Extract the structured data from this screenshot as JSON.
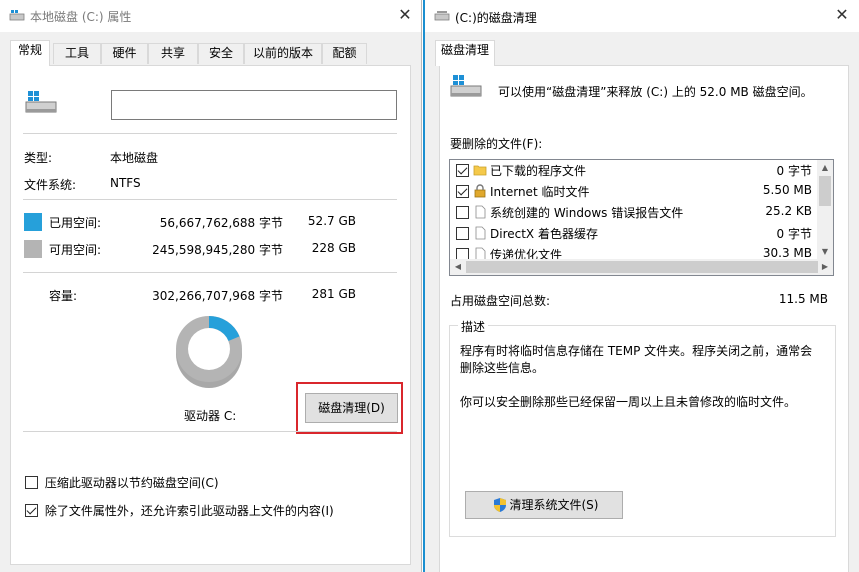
{
  "left_window": {
    "title": "本地磁盘 (C:) 属性",
    "tabs": [
      "常规",
      "工具",
      "硬件",
      "共享",
      "安全",
      "以前的版本",
      "配额"
    ],
    "active_tab": "常规",
    "drive_name_value": "",
    "type_label": "类型:",
    "type_value": "本地磁盘",
    "fs_label": "文件系统:",
    "fs_value": "NTFS",
    "used": {
      "label": "已用空间:",
      "bytes": "56,667,762,688 字节",
      "size": "52.7 GB",
      "color": "#26a0da"
    },
    "free": {
      "label": "可用空间:",
      "bytes": "245,598,945,280 字节",
      "size": "228 GB",
      "color": "#b4b4b4"
    },
    "capacity": {
      "label": "容量:",
      "bytes": "302,266,707,968 字节",
      "size": "281 GB"
    },
    "used_fraction": 0.187,
    "drive_label": "驱动器 C:",
    "cleanup_button": "磁盘清理(D)",
    "compress_label": "压缩此驱动器以节约磁盘空间(C)",
    "compress_checked": false,
    "index_label": "除了文件属性外，还允许索引此驱动器上文件的内容(I)",
    "index_checked": true
  },
  "right_window": {
    "title": "(C:)的磁盘清理",
    "tab": "磁盘清理",
    "intro": "可以使用“磁盘清理”来释放  (C:) 上的 52.0 MB 磁盘空间。",
    "files_label": "要删除的文件(F):",
    "files": [
      {
        "name": "已下载的程序文件",
        "size": "0 字节",
        "checked": true,
        "icon": "folder-icon"
      },
      {
        "name": "Internet 临时文件",
        "size": "5.50 MB",
        "checked": true,
        "icon": "lock-icon"
      },
      {
        "name": "系统创建的 Windows 错误报告文件",
        "size": "25.2 KB",
        "checked": false,
        "icon": "file-icon"
      },
      {
        "name": "DirectX 着色器缓存",
        "size": "0 字节",
        "checked": false,
        "icon": "file-icon"
      },
      {
        "name": "传递优化文件",
        "size": "30.3 MB",
        "checked": false,
        "icon": "file-icon"
      }
    ],
    "total_label": "占用磁盘空间总数:",
    "total_value": "11.5 MB",
    "description_legend": "描述",
    "description_p1": "程序有时将临时信息存储在 TEMP 文件夹。程序关闭之前，通常会删除这些信息。",
    "description_p2": "你可以安全删除那些已经保留一周以上且未曾修改的临时文件。",
    "system_button": "清理系统文件(S)"
  }
}
